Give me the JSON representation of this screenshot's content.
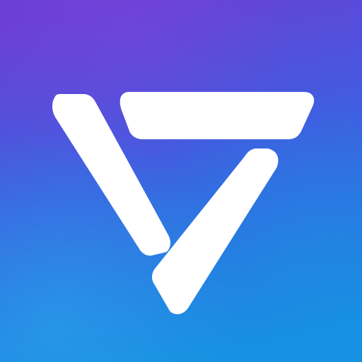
{
  "app_icon": {
    "logo": "triangular-v-logo",
    "colors": {
      "background_top": "#6a3fd6",
      "background_mid": "#3f5ee0",
      "background_bottom": "#1490e0",
      "glow": "#2aa6ee",
      "logo_fill": "#ffffff"
    }
  }
}
